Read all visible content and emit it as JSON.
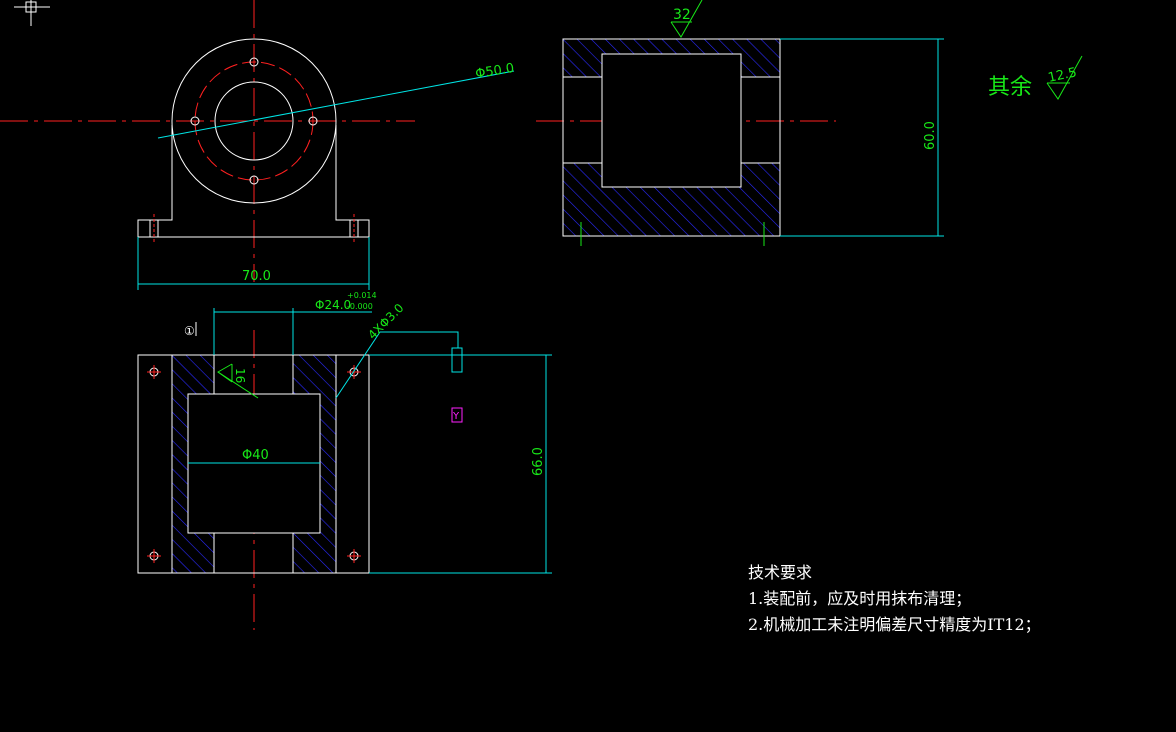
{
  "dimensions": {
    "outer_diameter": "Φ50.0",
    "base_width": "70.0",
    "bore_tolerance_label": "Φ24.0",
    "tol_upper": "+0.014",
    "tol_lower": "-0.000",
    "holes": "4XΦ3.0",
    "inner_diameter": "Φ40",
    "height_66": "66.0",
    "height_60": "60.0"
  },
  "roughness": {
    "top": "32",
    "side": "16",
    "other_label": "其余",
    "other_value": "12.5"
  },
  "markers": {
    "datum": "①",
    "section": "Y"
  },
  "notes": {
    "title": "技术要求",
    "line1": "1.装配前，应及时用抹布清理；",
    "line2": "2.机械加工未注明偏差尺寸精度为IT12；"
  },
  "colors": {
    "outline": "#ffffff",
    "centerline": "#ff2020",
    "dimension": "#00e5e5",
    "text_green": "#18e818",
    "hatch": "#2020ff",
    "magenta": "#ff20ff"
  }
}
